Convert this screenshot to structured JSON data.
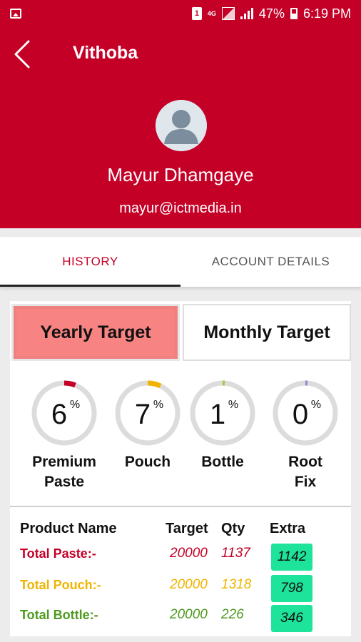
{
  "status_bar": {
    "battery": "47%",
    "time": "6:19 PM",
    "network": "4G"
  },
  "header": {
    "title": "Vithoba",
    "user_name": "Mayur Dhamgaye",
    "email": "mayur@ictmedia.in"
  },
  "tabs": [
    {
      "label": "HISTORY"
    },
    {
      "label": "ACCOUNT DETAILS"
    }
  ],
  "targets": {
    "yearly": "Yearly Target",
    "monthly": "Monthly Target"
  },
  "gauges": [
    {
      "value": "6",
      "unit": "%",
      "label_line1": "Premium",
      "label_line2": "Paste",
      "color": "#c40027",
      "percent": 6
    },
    {
      "value": "7",
      "unit": "%",
      "label_line1": "Pouch",
      "label_line2": "",
      "color": "#f0b400",
      "percent": 7
    },
    {
      "value": "1",
      "unit": "%",
      "label_line1": "Bottle",
      "label_line2": "",
      "color": "#9ccc3a",
      "percent": 1
    },
    {
      "value": "0",
      "unit": "%",
      "label_line1": "Root",
      "label_line2": "Fix",
      "color": "#8a8fc9",
      "percent": 0
    }
  ],
  "table": {
    "headers": {
      "name": "Product Name",
      "target": "Target",
      "qty": "Qty",
      "extra": "Extra"
    },
    "rows": [
      {
        "name": "Total Paste:-",
        "target": "20000",
        "qty": "1137",
        "extra": "1142",
        "color": "#c40027"
      },
      {
        "name": "Total Pouch:-",
        "target": "20000",
        "qty": "1318",
        "extra": "798",
        "color": "#f0b400"
      },
      {
        "name": "Total Bottle:-",
        "target": "20000",
        "qty": "226",
        "extra": "346",
        "color": "#4c9a1e"
      }
    ]
  }
}
